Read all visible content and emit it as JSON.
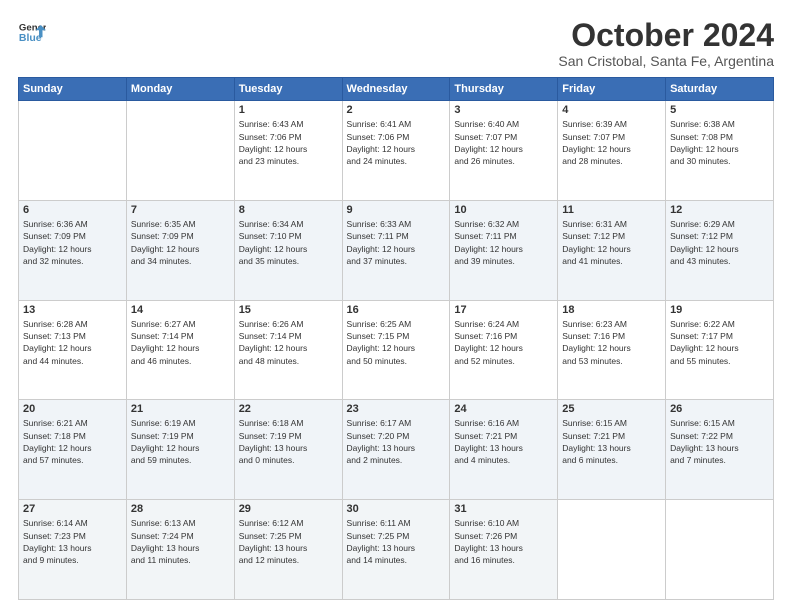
{
  "header": {
    "logo_line1": "General",
    "logo_line2": "Blue",
    "title": "October 2024",
    "subtitle": "San Cristobal, Santa Fe, Argentina"
  },
  "days_of_week": [
    "Sunday",
    "Monday",
    "Tuesday",
    "Wednesday",
    "Thursday",
    "Friday",
    "Saturday"
  ],
  "weeks": [
    {
      "days": [
        {
          "num": "",
          "sunrise": "",
          "sunset": "",
          "daylight": ""
        },
        {
          "num": "",
          "sunrise": "",
          "sunset": "",
          "daylight": ""
        },
        {
          "num": "1",
          "sunrise": "Sunrise: 6:43 AM",
          "sunset": "Sunset: 7:06 PM",
          "daylight": "Daylight: 12 hours and 23 minutes."
        },
        {
          "num": "2",
          "sunrise": "Sunrise: 6:41 AM",
          "sunset": "Sunset: 7:06 PM",
          "daylight": "Daylight: 12 hours and 24 minutes."
        },
        {
          "num": "3",
          "sunrise": "Sunrise: 6:40 AM",
          "sunset": "Sunset: 7:07 PM",
          "daylight": "Daylight: 12 hours and 26 minutes."
        },
        {
          "num": "4",
          "sunrise": "Sunrise: 6:39 AM",
          "sunset": "Sunset: 7:07 PM",
          "daylight": "Daylight: 12 hours and 28 minutes."
        },
        {
          "num": "5",
          "sunrise": "Sunrise: 6:38 AM",
          "sunset": "Sunset: 7:08 PM",
          "daylight": "Daylight: 12 hours and 30 minutes."
        }
      ]
    },
    {
      "days": [
        {
          "num": "6",
          "sunrise": "Sunrise: 6:36 AM",
          "sunset": "Sunset: 7:09 PM",
          "daylight": "Daylight: 12 hours and 32 minutes."
        },
        {
          "num": "7",
          "sunrise": "Sunrise: 6:35 AM",
          "sunset": "Sunset: 7:09 PM",
          "daylight": "Daylight: 12 hours and 34 minutes."
        },
        {
          "num": "8",
          "sunrise": "Sunrise: 6:34 AM",
          "sunset": "Sunset: 7:10 PM",
          "daylight": "Daylight: 12 hours and 35 minutes."
        },
        {
          "num": "9",
          "sunrise": "Sunrise: 6:33 AM",
          "sunset": "Sunset: 7:11 PM",
          "daylight": "Daylight: 12 hours and 37 minutes."
        },
        {
          "num": "10",
          "sunrise": "Sunrise: 6:32 AM",
          "sunset": "Sunset: 7:11 PM",
          "daylight": "Daylight: 12 hours and 39 minutes."
        },
        {
          "num": "11",
          "sunrise": "Sunrise: 6:31 AM",
          "sunset": "Sunset: 7:12 PM",
          "daylight": "Daylight: 12 hours and 41 minutes."
        },
        {
          "num": "12",
          "sunrise": "Sunrise: 6:29 AM",
          "sunset": "Sunset: 7:12 PM",
          "daylight": "Daylight: 12 hours and 43 minutes."
        }
      ]
    },
    {
      "days": [
        {
          "num": "13",
          "sunrise": "Sunrise: 6:28 AM",
          "sunset": "Sunset: 7:13 PM",
          "daylight": "Daylight: 12 hours and 44 minutes."
        },
        {
          "num": "14",
          "sunrise": "Sunrise: 6:27 AM",
          "sunset": "Sunset: 7:14 PM",
          "daylight": "Daylight: 12 hours and 46 minutes."
        },
        {
          "num": "15",
          "sunrise": "Sunrise: 6:26 AM",
          "sunset": "Sunset: 7:14 PM",
          "daylight": "Daylight: 12 hours and 48 minutes."
        },
        {
          "num": "16",
          "sunrise": "Sunrise: 6:25 AM",
          "sunset": "Sunset: 7:15 PM",
          "daylight": "Daylight: 12 hours and 50 minutes."
        },
        {
          "num": "17",
          "sunrise": "Sunrise: 6:24 AM",
          "sunset": "Sunset: 7:16 PM",
          "daylight": "Daylight: 12 hours and 52 minutes."
        },
        {
          "num": "18",
          "sunrise": "Sunrise: 6:23 AM",
          "sunset": "Sunset: 7:16 PM",
          "daylight": "Daylight: 12 hours and 53 minutes."
        },
        {
          "num": "19",
          "sunrise": "Sunrise: 6:22 AM",
          "sunset": "Sunset: 7:17 PM",
          "daylight": "Daylight: 12 hours and 55 minutes."
        }
      ]
    },
    {
      "days": [
        {
          "num": "20",
          "sunrise": "Sunrise: 6:21 AM",
          "sunset": "Sunset: 7:18 PM",
          "daylight": "Daylight: 12 hours and 57 minutes."
        },
        {
          "num": "21",
          "sunrise": "Sunrise: 6:19 AM",
          "sunset": "Sunset: 7:19 PM",
          "daylight": "Daylight: 12 hours and 59 minutes."
        },
        {
          "num": "22",
          "sunrise": "Sunrise: 6:18 AM",
          "sunset": "Sunset: 7:19 PM",
          "daylight": "Daylight: 13 hours and 0 minutes."
        },
        {
          "num": "23",
          "sunrise": "Sunrise: 6:17 AM",
          "sunset": "Sunset: 7:20 PM",
          "daylight": "Daylight: 13 hours and 2 minutes."
        },
        {
          "num": "24",
          "sunrise": "Sunrise: 6:16 AM",
          "sunset": "Sunset: 7:21 PM",
          "daylight": "Daylight: 13 hours and 4 minutes."
        },
        {
          "num": "25",
          "sunrise": "Sunrise: 6:15 AM",
          "sunset": "Sunset: 7:21 PM",
          "daylight": "Daylight: 13 hours and 6 minutes."
        },
        {
          "num": "26",
          "sunrise": "Sunrise: 6:15 AM",
          "sunset": "Sunset: 7:22 PM",
          "daylight": "Daylight: 13 hours and 7 minutes."
        }
      ]
    },
    {
      "days": [
        {
          "num": "27",
          "sunrise": "Sunrise: 6:14 AM",
          "sunset": "Sunset: 7:23 PM",
          "daylight": "Daylight: 13 hours and 9 minutes."
        },
        {
          "num": "28",
          "sunrise": "Sunrise: 6:13 AM",
          "sunset": "Sunset: 7:24 PM",
          "daylight": "Daylight: 13 hours and 11 minutes."
        },
        {
          "num": "29",
          "sunrise": "Sunrise: 6:12 AM",
          "sunset": "Sunset: 7:25 PM",
          "daylight": "Daylight: 13 hours and 12 minutes."
        },
        {
          "num": "30",
          "sunrise": "Sunrise: 6:11 AM",
          "sunset": "Sunset: 7:25 PM",
          "daylight": "Daylight: 13 hours and 14 minutes."
        },
        {
          "num": "31",
          "sunrise": "Sunrise: 6:10 AM",
          "sunset": "Sunset: 7:26 PM",
          "daylight": "Daylight: 13 hours and 16 minutes."
        },
        {
          "num": "",
          "sunrise": "",
          "sunset": "",
          "daylight": ""
        },
        {
          "num": "",
          "sunrise": "",
          "sunset": "",
          "daylight": ""
        }
      ]
    }
  ]
}
